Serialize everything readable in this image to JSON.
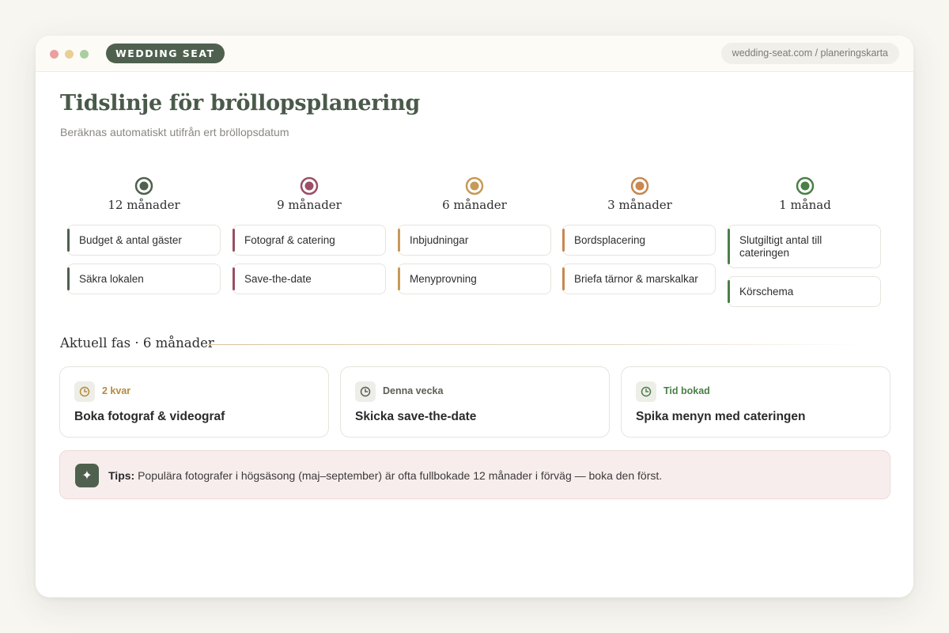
{
  "window": {
    "brand": "WEDDING SEAT",
    "url": "wedding-seat.com / planeringskarta"
  },
  "header": {
    "title": "Tidslinje för bröllopsplanering",
    "subtitle": "Beräknas automatiskt utifrån ert bröllopsdatum"
  },
  "colors": {
    "green": "#4f604f",
    "rose": "#9a4f64",
    "gold": "#c69a58",
    "copper": "#c8884f",
    "leaf": "#4b7f48"
  },
  "timeline": {
    "stages": [
      {
        "label": "12 månader",
        "tasks": [
          "Budget & antal gäster",
          "Säkra lokalen"
        ]
      },
      {
        "label": "9 månader",
        "tasks": [
          "Fotograf & catering",
          "Save-the-date"
        ]
      },
      {
        "label": "6 månader",
        "tasks": [
          "Inbjudningar",
          "Menyprovning"
        ]
      },
      {
        "label": "3 månader",
        "tasks": [
          "Bordsplacering",
          "Briefa tärnor & marskalkar"
        ]
      },
      {
        "label": "1 månad",
        "tasks": [
          "Slutgiltigt antal till cateringen",
          "Körschema"
        ]
      }
    ]
  },
  "current": {
    "heading": "Aktuell fas · 6 månader",
    "tasks": [
      {
        "tag": "2 kvar",
        "title": "Boka fotograf & videograf",
        "tag_color": "#b58a3e",
        "icon": "clock-icon"
      },
      {
        "tag": "Denna vecka",
        "title": "Skicka save-the-date",
        "tag_color": "#5d5d57",
        "icon": "clock-icon"
      },
      {
        "tag": "Tid bokad",
        "title": "Spika menyn med cateringen",
        "tag_color": "#4b7f48",
        "icon": "clock-icon"
      }
    ]
  },
  "tips": {
    "label": "Tips:",
    "text": "Populära fotografer i högsäsong (maj–september) är ofta fullbokade 12 månader i förväg — boka den först.",
    "icon": "sparkle-icon"
  }
}
